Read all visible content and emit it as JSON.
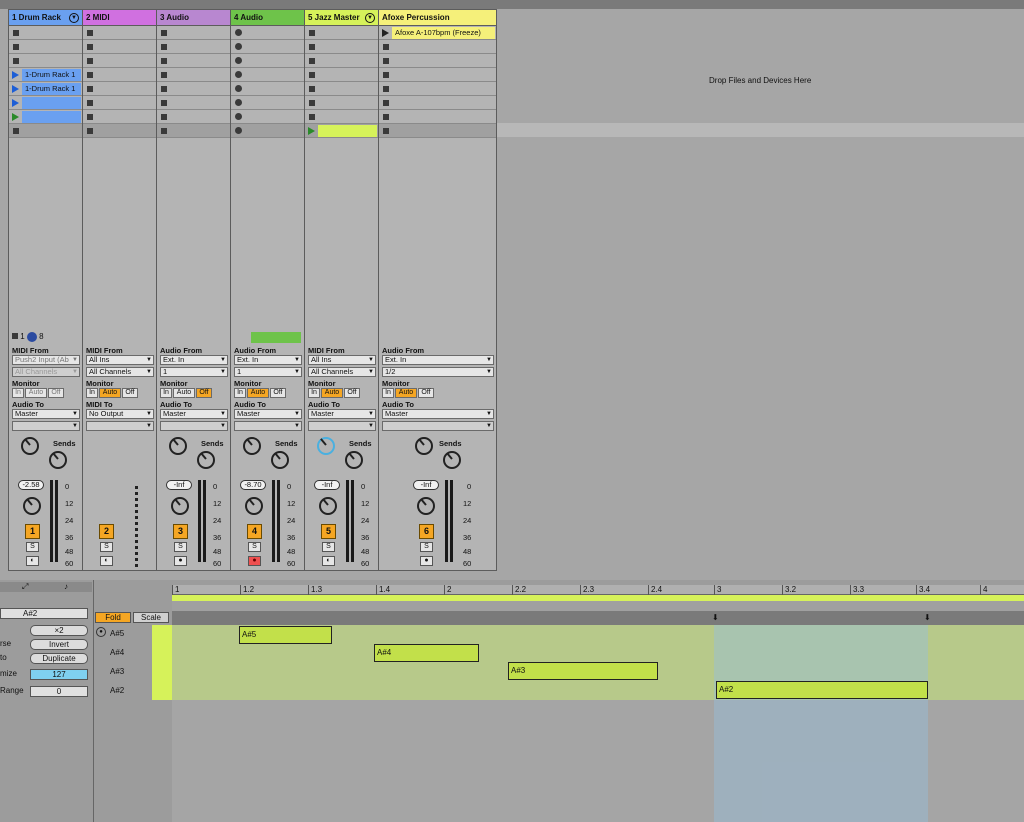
{
  "tracks": [
    {
      "name": "1 Drum Rack",
      "color": "#6aa0f0",
      "io_head": "MIDI From",
      "io_from": "Push2 Input (Ab",
      "io_from2": "All Channels",
      "to_head": "Audio To",
      "to": "Master",
      "vol": "-2.58",
      "num": "1",
      "clips": [
        "",
        "",
        "",
        "1-Drum Rack 1",
        "1-Drum Rack 1",
        "",
        ""
      ]
    },
    {
      "name": "2 MIDI",
      "color": "#d070e0",
      "io_head": "MIDI From",
      "io_from": "All Ins",
      "io_from2": "All Channels",
      "to_head": "MIDI To",
      "to": "No Output",
      "vol": "",
      "num": "2",
      "clips": []
    },
    {
      "name": "3 Audio",
      "color": "#b887d0",
      "io_head": "Audio From",
      "io_from": "Ext. In",
      "io_from2": "1",
      "to_head": "Audio To",
      "to": "Master",
      "vol": "-Inf",
      "num": "3",
      "clips": []
    },
    {
      "name": "4 Audio",
      "color": "#6ec34a",
      "io_head": "Audio From",
      "io_from": "Ext. In",
      "io_from2": "1",
      "to_head": "Audio To",
      "to": "Master",
      "vol": "-8.70",
      "num": "4",
      "clips": []
    },
    {
      "name": "5 Jazz Master",
      "color": "#d6f25a",
      "io_head": "MIDI From",
      "io_from": "All Ins",
      "io_from2": "All Channels",
      "to_head": "Audio To",
      "to": "Master",
      "vol": "-Inf",
      "num": "5",
      "clips": []
    },
    {
      "name": "Afoxe Percussion",
      "color": "#f5f07a",
      "io_head": "Audio From",
      "io_from": "Ext. In",
      "io_from2": "1/2",
      "to_head": "Audio To",
      "to": "Master",
      "vol": "-Inf",
      "num": "6",
      "clips": [
        "Afoxe A-107bpm (Freeze)"
      ]
    }
  ],
  "monitor": {
    "label": "Monitor",
    "in": "In",
    "auto": "Auto",
    "off": "Off"
  },
  "sends": "Sends",
  "knob_a": "A",
  "knob_b": "B",
  "solo": "S",
  "meter_scale": [
    "0",
    "12",
    "24",
    "36",
    "48",
    "60"
  ],
  "drop_text": "Drop Files and Devices Here",
  "drum_range": {
    "low": "1",
    "high": "8"
  },
  "clip_panel": {
    "fold": "Fold",
    "scale": "Scale",
    "key": "A#2",
    "x2": "×2",
    "invert": "Invert",
    "duplicate": "Duplicate",
    "velocity": "127",
    "range": "0",
    "l_rse": "rse",
    "l_to": "to",
    "l_mize": "mize",
    "l_range": "Range",
    "ruler": [
      "1",
      "1.2",
      "1.3",
      "1.4",
      "2",
      "2.2",
      "2.3",
      "2.4",
      "3",
      "3.2",
      "3.3",
      "3.4",
      "4"
    ],
    "keys": [
      "A#5",
      "A#4",
      "A#3",
      "A#2"
    ],
    "notes": [
      "A#5",
      "A#4",
      "A#3",
      "A#2"
    ]
  }
}
